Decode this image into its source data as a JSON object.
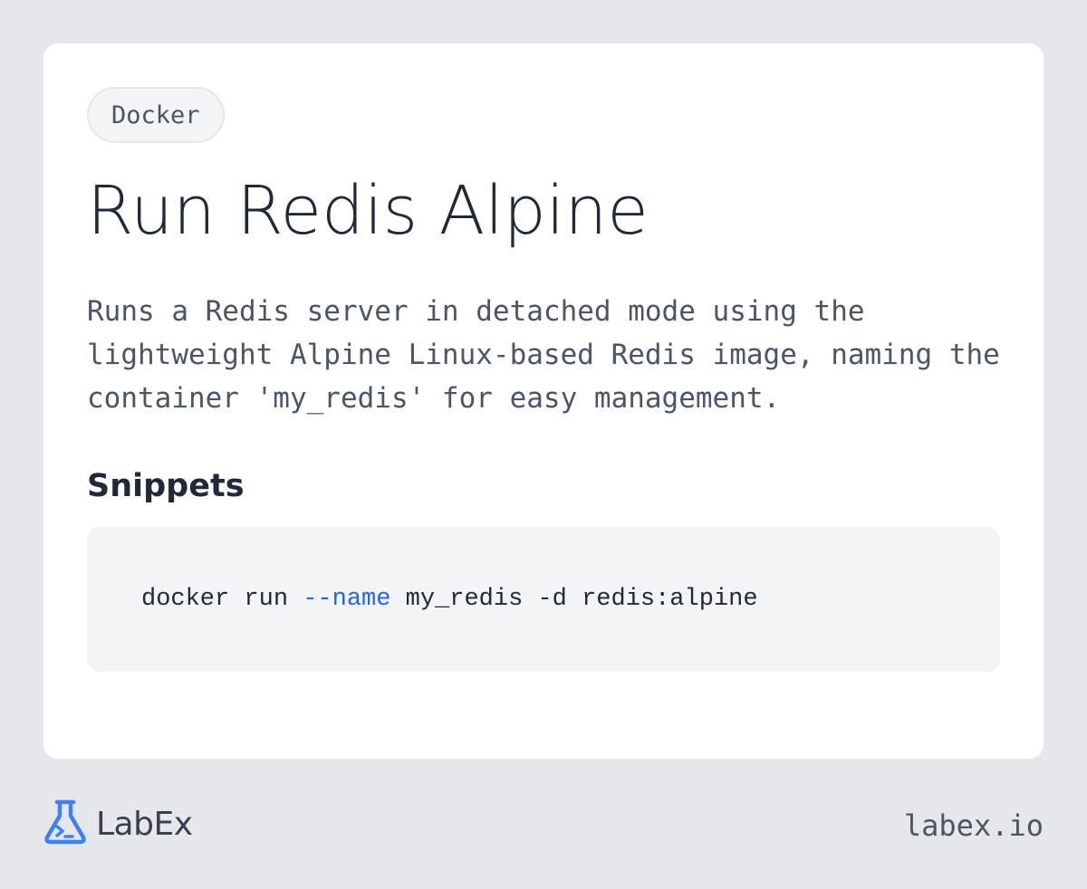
{
  "card": {
    "tag": "Docker",
    "title": "Run Redis Alpine",
    "description": "Runs a Redis server in detached mode using the lightweight Alpine Linux-based Redis image, naming the container 'my_redis' for easy management.",
    "snippets_heading": "Snippets",
    "snippet": {
      "command": "docker run ",
      "flag": "--name",
      "rest": " my_redis -d redis:alpine"
    }
  },
  "footer": {
    "logo_icon": "flask-terminal-icon",
    "logo_text": "LabEx",
    "url": "labex.io"
  },
  "colors": {
    "background": "#e5e7eb",
    "card": "#ffffff",
    "accent": "#2563eb",
    "logo_blue": "#3b82f6"
  }
}
